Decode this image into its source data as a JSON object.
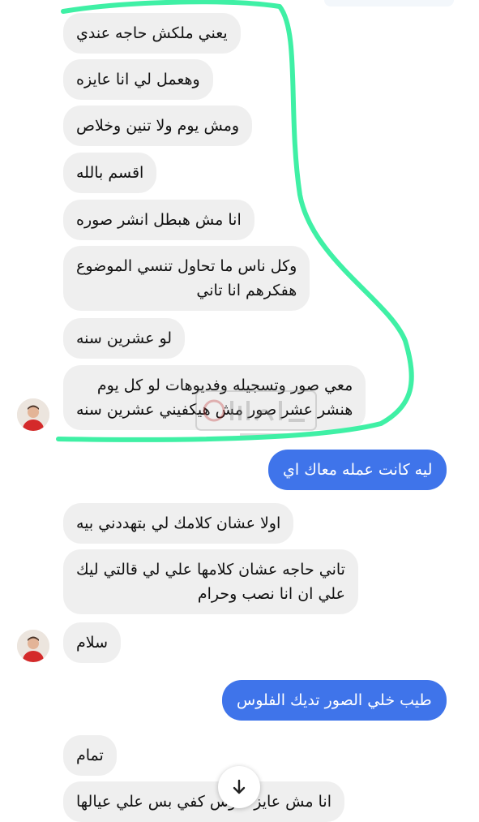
{
  "colors": {
    "incoming_bubble": "#efefef",
    "outgoing_bubble": "#3f74ea",
    "highlight_stroke": "#3ff0a5",
    "page_background": "#ffffff"
  },
  "icons": {
    "avatar": "sender-avatar-icon",
    "scroll": "arrow-down-icon",
    "watermark": "site-logo-watermark"
  },
  "messages": [
    {
      "dir": "in",
      "lines": [
        "يعني ملكش حاجه عندي"
      ]
    },
    {
      "dir": "in",
      "lines": [
        "وهعمل لي انا عايزه"
      ]
    },
    {
      "dir": "in",
      "lines": [
        "ومش يوم ولا تنين وخلاص"
      ]
    },
    {
      "dir": "in",
      "lines": [
        "اقسم بالله"
      ]
    },
    {
      "dir": "in",
      "lines": [
        "انا مش هبطل انشر صوره"
      ]
    },
    {
      "dir": "in",
      "lines": [
        "وكل ناس ما تحاول تنسي الموضوع",
        "هفكرهم انا تاني"
      ]
    },
    {
      "dir": "in",
      "lines": [
        "لو عشرين سنه"
      ]
    },
    {
      "dir": "in",
      "lines": [
        "معي صور وتسجيله وفديوهات لو كل يوم",
        "هنشر عشر صور مش هيكفيني عشرين سنه"
      ]
    },
    {
      "dir": "out",
      "lines": [
        "ليه كانت عمله معاك اي"
      ]
    },
    {
      "dir": "in",
      "lines": [
        "اولا عشان كلامك لي بتهددني بيه"
      ]
    },
    {
      "dir": "in",
      "lines": [
        "تاني حاجه عشان كلامها علي لي قالتي ليك",
        "علي ان انا نصب وحرام"
      ]
    },
    {
      "dir": "in",
      "lines": [
        "سلام"
      ]
    },
    {
      "dir": "out",
      "lines": [
        "طيب خلي الصور تديك الفلوس"
      ]
    },
    {
      "dir": "in",
      "lines": [
        "تمام"
      ]
    },
    {
      "dir": "in",
      "lines": [
        "انا مش عايز فلوس كفي بس علي عيالها"
      ]
    }
  ]
}
